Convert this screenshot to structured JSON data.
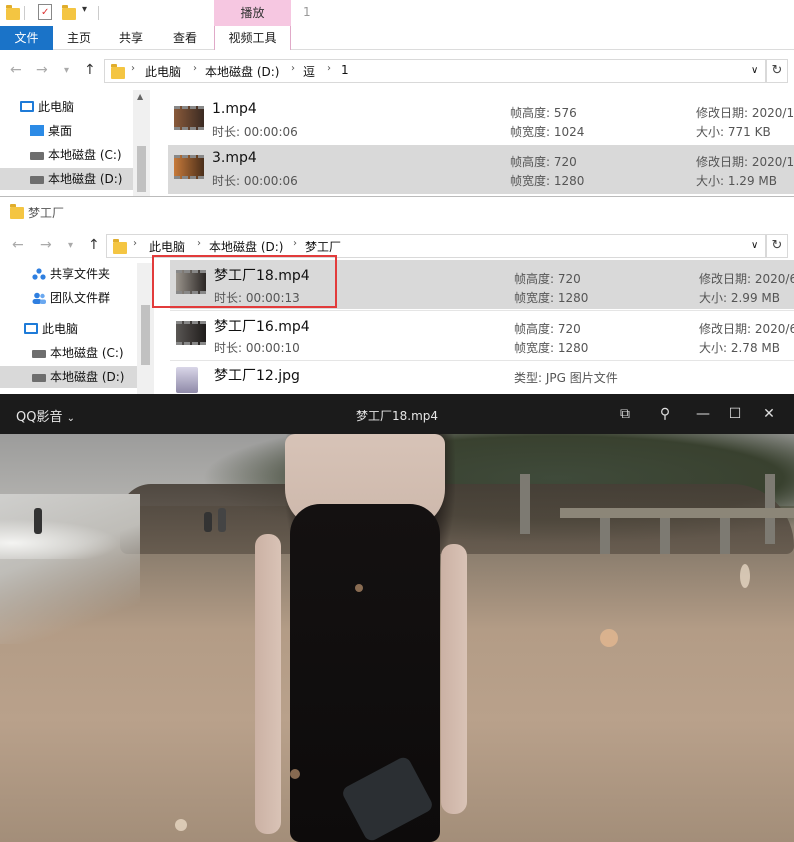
{
  "window1": {
    "quick_access_counter": "1",
    "ribbon": {
      "context_header": "播放",
      "tabs": [
        "文件",
        "主页",
        "共享",
        "查看"
      ],
      "context_tab": "视频工具"
    },
    "breadcrumbs": [
      "此电脑",
      "本地磁盘 (D:)",
      "逗",
      "1"
    ],
    "nav": [
      "此电脑",
      "桌面",
      "本地磁盘 (C:)",
      "本地磁盘 (D:)"
    ],
    "files": [
      {
        "name": "1.mp4",
        "duration_label": "时长: 00:00:06",
        "height_label": "帧高度: 576",
        "width_label": "帧宽度: 1024",
        "modified_label": "修改日期: 2020/1",
        "size_label": "大小: 771 KB"
      },
      {
        "name": "3.mp4",
        "duration_label": "时长: 00:00:06",
        "height_label": "帧高度: 720",
        "width_label": "帧宽度: 1280",
        "modified_label": "修改日期: 2020/1",
        "size_label": "大小: 1.29 MB"
      }
    ]
  },
  "window2": {
    "title": "梦工厂",
    "breadcrumbs": [
      "此电脑",
      "本地磁盘 (D:)",
      "梦工厂"
    ],
    "nav": [
      "共享文件夹",
      "团队文件群",
      "此电脑",
      "本地磁盘 (C:)",
      "本地磁盘 (D:)"
    ],
    "files": [
      {
        "name": "梦工厂18.mp4",
        "duration_label": "时长: 00:00:13",
        "height_label": "帧高度: 720",
        "width_label": "帧宽度: 1280",
        "modified_label": "修改日期: 2020/6",
        "size_label": "大小: 2.99 MB"
      },
      {
        "name": "梦工厂16.mp4",
        "duration_label": "时长: 00:00:10",
        "height_label": "帧高度: 720",
        "width_label": "帧宽度: 1280",
        "modified_label": "修改日期: 2020/6",
        "size_label": "大小: 2.78 MB"
      },
      {
        "name": "梦工厂12.jpg",
        "type_label": "类型: JPG 图片文件"
      }
    ]
  },
  "player": {
    "brand": "QQ影音",
    "title": "梦工厂18.mp4"
  }
}
